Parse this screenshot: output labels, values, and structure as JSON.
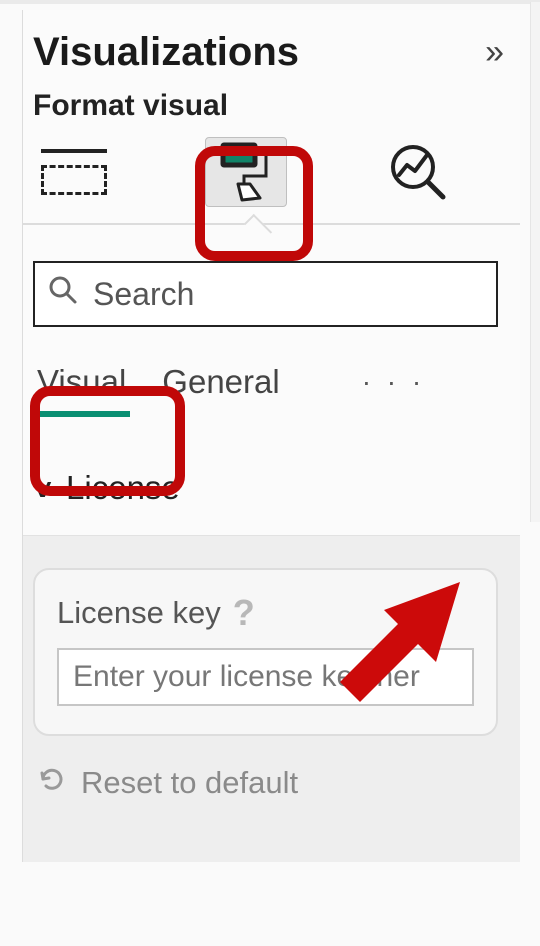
{
  "header": {
    "title": "Visualizations"
  },
  "subtitle": "Format visual",
  "search": {
    "placeholder": "Search"
  },
  "tabs": {
    "visual": "Visual",
    "general": "General"
  },
  "section": {
    "license": "License"
  },
  "licenseCard": {
    "label": "License key",
    "placeholder": "Enter your license key her"
  },
  "footer": {
    "reset": "Reset to default"
  }
}
